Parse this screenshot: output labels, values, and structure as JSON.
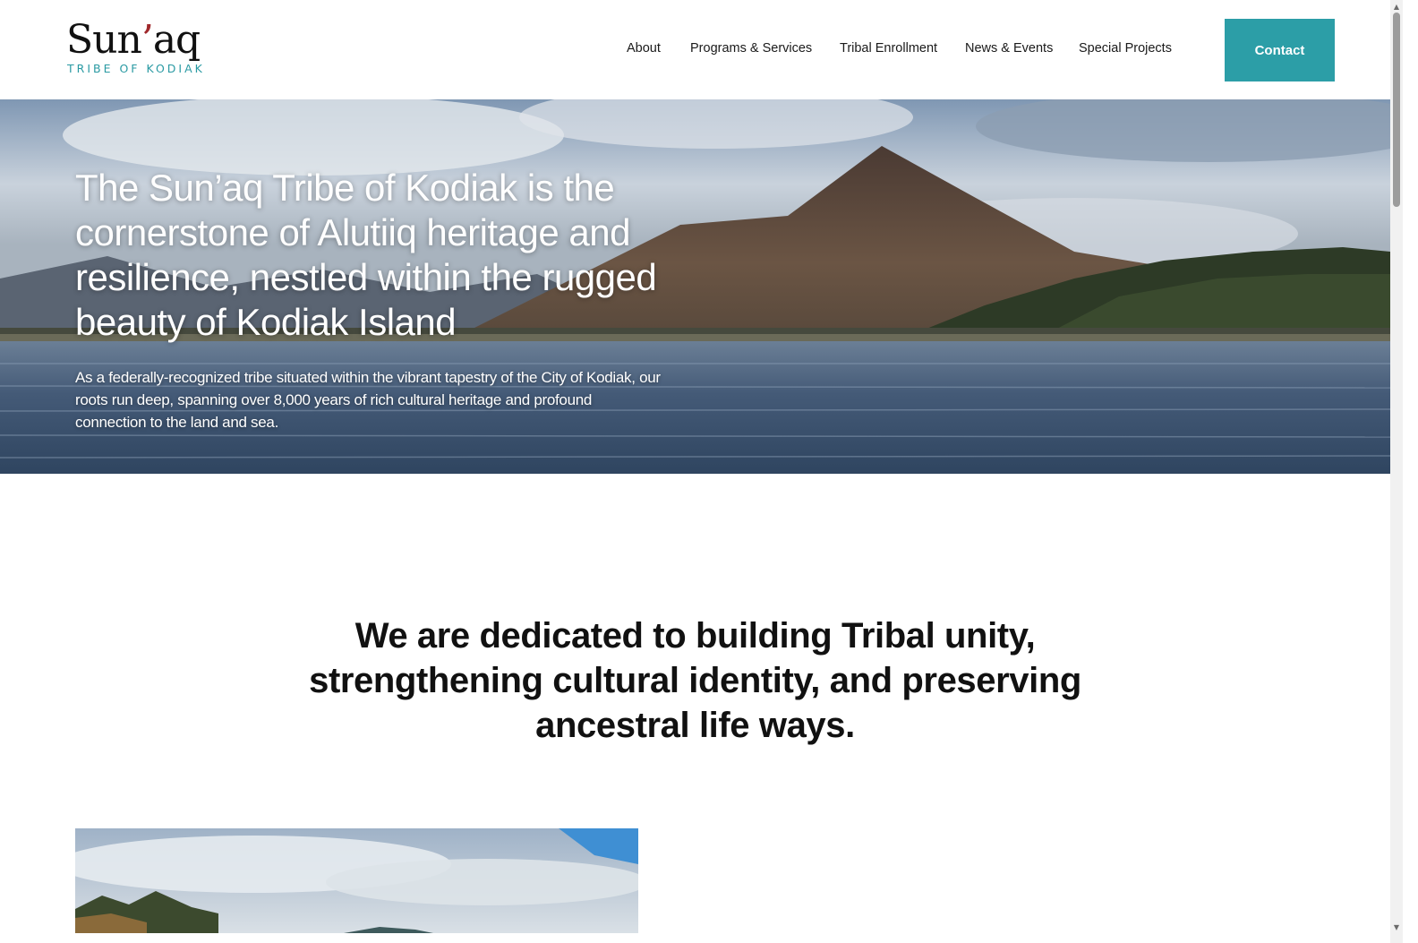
{
  "header": {
    "logo": {
      "word": "Sun",
      "accent": "’",
      "word_end": "aq",
      "subtitle": "TRIBE OF KODIAK"
    },
    "nav": [
      {
        "label": "About"
      },
      {
        "label": "Programs & Services"
      },
      {
        "label": "Tribal Enrollment"
      },
      {
        "label": "News & Events"
      },
      {
        "label": "Special Projects"
      }
    ],
    "contact_label": "Contact"
  },
  "hero": {
    "title": "The Sun’aq Tribe of Kodiak is the cornerstone of Alutiiq heritage and resilience, nestled within the rugged beauty of Kodiak Island",
    "text": "As a federally-recognized tribe situated within the vibrant tapestry of the City of Kodiak, our roots run deep, spanning over 8,000 years of rich cultural heritage and profound connection to the land and sea."
  },
  "mission": {
    "text": "We are dedicated to building Tribal unity, strengthening cultural identity, and preserving ancestral life ways."
  },
  "colors": {
    "accent": "#2c9ea7",
    "logo_accent": "#a0292c",
    "logo_subtitle": "#2a9aa3"
  },
  "icons": {
    "scroll_up": "scroll-up-arrow-icon",
    "scroll_down": "scroll-down-arrow-icon"
  }
}
